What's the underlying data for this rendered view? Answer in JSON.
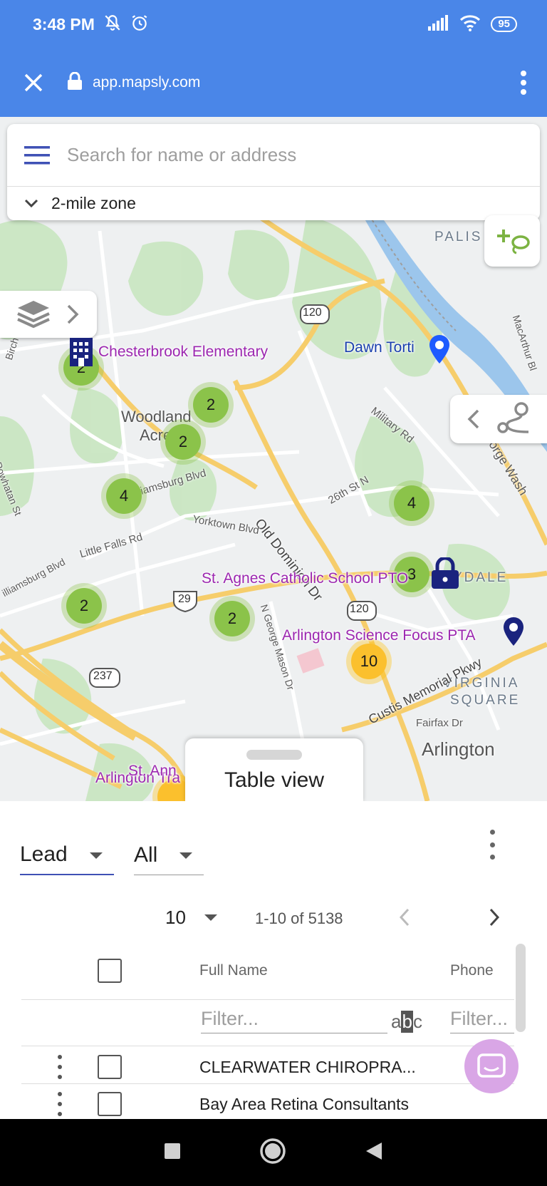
{
  "status_bar": {
    "time": "3:48 PM",
    "battery": "95",
    "icons": [
      "mute-icon",
      "alarm-icon",
      "signal-icon",
      "wifi-icon",
      "battery-icon"
    ]
  },
  "browser": {
    "url": "app.mapsly.com",
    "icons": [
      "close-icon",
      "lock-icon",
      "more-vert-icon"
    ]
  },
  "map": {
    "search_placeholder": "Search for name or address",
    "zone_label": "2-mile zone",
    "places": {
      "chesterbrook": "Chesterbrook Elementary",
      "dawn": "Dawn Torti",
      "st_agnes": "St. Agnes Catholic School PTO",
      "arlington_science": "Arlington Science Focus PTA",
      "arlington_tra": "Arlington Tra",
      "st_ann": "St. Ann"
    },
    "clusters": {
      "c1": "2",
      "c2": "2",
      "c3": "2",
      "c4": "4",
      "c5": "4",
      "c6": "3",
      "c7": "2",
      "c8": "2",
      "c9": "10"
    },
    "map_labels": {
      "woodland": "Woodland",
      "acres": "Acres",
      "palis": "PALIS",
      "lyndale": "YDALE",
      "virginia": "VIRGINIA",
      "square": "SQUARE",
      "arlington": "Arlington",
      "old_dominion": "Old Dominion Dr",
      "williamsburg": "Williamsburg Blvd",
      "yorktown": "Yorktown Blvd",
      "little_falls": "Little Falls Rd",
      "military": "Military Rd",
      "n26th": "26th St N",
      "custis": "Custis Memorial Pkwy",
      "fairfax": "Fairfax Dr",
      "n_george_mason": "N George Mason Dr",
      "birch": "Birch Rd",
      "powhatan": "Powhatan St",
      "iamsburg": "illiamsburg Blvd",
      "george_wash": "eorge Wash",
      "macarthur": "MacArthur Bl",
      "r120a": "120",
      "r120b": "120",
      "r29": "29",
      "r237": "237"
    },
    "table_view_label": "Table view"
  },
  "panel": {
    "object_select": "Lead",
    "filter_select": "All",
    "page_size": "10",
    "range_text": "1-10 of 5138",
    "columns": {
      "full_name": "Full Name",
      "phone": "Phone"
    },
    "filter_placeholder": "Filter...",
    "filter_placeholder_phone": "Filter...",
    "abc_badge_a": "a",
    "abc_badge_b": "b",
    "abc_badge_c": "c",
    "rows": [
      {
        "full_name": "CLEARWATER CHIROPRA..."
      },
      {
        "full_name": "Bay Area Retina Consultants"
      }
    ]
  },
  "colors": {
    "header_blue": "#4a86e8",
    "cluster_green": "#8bc34a",
    "cluster_yellow": "#fbc02d",
    "place_purple": "#9c27b0",
    "accent_navy": "#1a237e"
  }
}
